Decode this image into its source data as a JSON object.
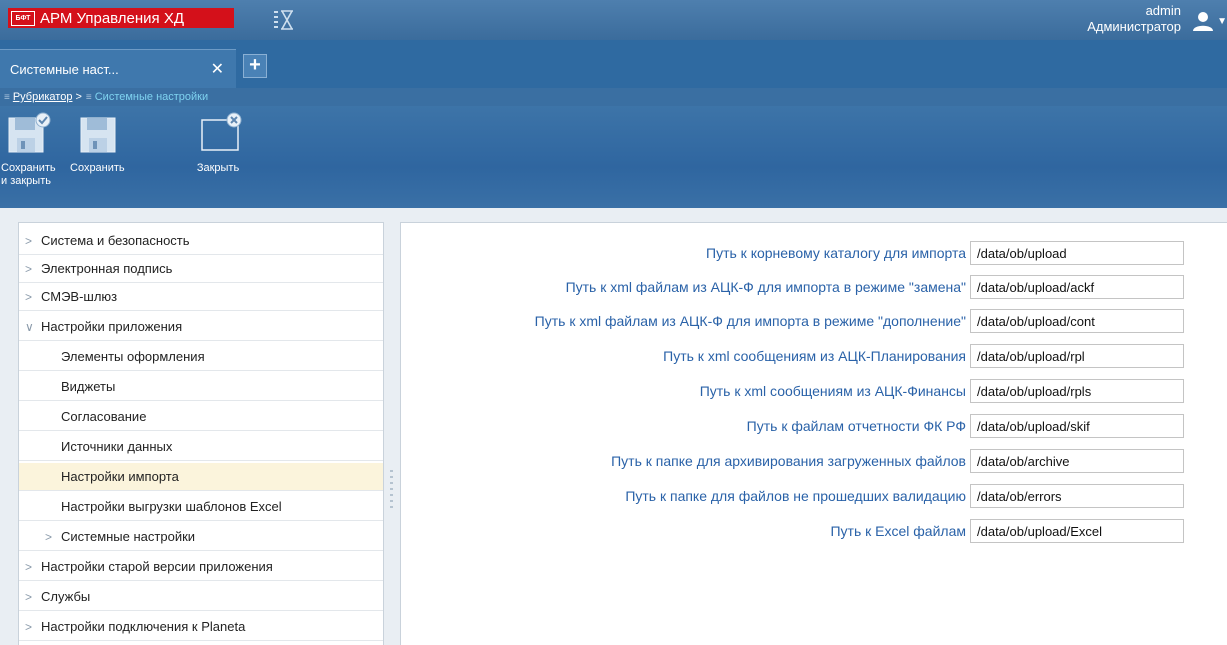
{
  "header": {
    "logo_text": "БФТ",
    "app_title": "АРМ Управления ХД",
    "user_name": "admin",
    "user_role": "Администратор"
  },
  "tabs": [
    {
      "label": "Системные наст...",
      "active": true
    }
  ],
  "breadcrumb": {
    "items": [
      {
        "label": "Рубрикатор"
      },
      {
        "label": "Системные настройки"
      }
    ],
    "separator": ">"
  },
  "toolbar": {
    "save_close_label_1": "Сохранить",
    "save_close_label_2": "и закрыть",
    "save_label": "Сохранить",
    "close_label": "Закрыть"
  },
  "tree": [
    {
      "label": "Система и безопасность",
      "level": 1,
      "expanded": false
    },
    {
      "label": "Электронная подпись",
      "level": 1,
      "expanded": false
    },
    {
      "label": "СМЭВ-шлюз",
      "level": 1,
      "expanded": false
    },
    {
      "label": "Настройки приложения",
      "level": 1,
      "expanded": true
    },
    {
      "label": "Элементы оформления",
      "level": 2
    },
    {
      "label": "Виджеты",
      "level": 2
    },
    {
      "label": "Согласование",
      "level": 2
    },
    {
      "label": "Источники данных",
      "level": 2
    },
    {
      "label": "Настройки импорта",
      "level": 2,
      "selected": true
    },
    {
      "label": "Настройки выгрузки шаблонов Excel",
      "level": 2
    },
    {
      "label": "Системные настройки",
      "level": 2,
      "expanded": false
    },
    {
      "label": "Настройки старой версии приложения",
      "level": 1,
      "expanded": false
    },
    {
      "label": "Службы",
      "level": 1,
      "expanded": false
    },
    {
      "label": "Настройки подключения к Planeta",
      "level": 1,
      "expanded": false
    }
  ],
  "form": {
    "fields": [
      {
        "label": "Путь к корневому каталогу для импорта",
        "value": "/data/ob/upload"
      },
      {
        "label": "Путь к xml файлам из АЦК-Ф для импорта в режиме \"замена\"",
        "value": "/data/ob/upload/ackf"
      },
      {
        "label": "Путь к xml файлам из АЦК-Ф для импорта в режиме \"дополнение\"",
        "value": "/data/ob/upload/cont"
      },
      {
        "label": "Путь к xml сообщениям из АЦК-Планирования",
        "value": "/data/ob/upload/rpl"
      },
      {
        "label": "Путь к xml сообщениям из АЦК-Финансы",
        "value": "/data/ob/upload/rpls"
      },
      {
        "label": "Путь к файлам отчетности ФК РФ",
        "value": "/data/ob/upload/skif"
      },
      {
        "label": "Путь к папке для архивирования загруженных файлов",
        "value": "/data/ob/archive"
      },
      {
        "label": "Путь к папке для файлов не прошедших валидацию",
        "value": "/data/ob/errors"
      },
      {
        "label": "Путь к Excel файлам",
        "value": "/data/ob/upload/Excel"
      }
    ]
  },
  "colors": {
    "header_blue": "#3b6c9c",
    "brand_red": "#d4101a",
    "label_blue": "#2a62a8",
    "selected_row": "#fbf4dc"
  },
  "icons": [
    "hourglass-icon",
    "user-icon",
    "save-close-icon",
    "save-icon",
    "close-window-icon",
    "chevron-right-icon",
    "chevron-down-icon"
  ]
}
